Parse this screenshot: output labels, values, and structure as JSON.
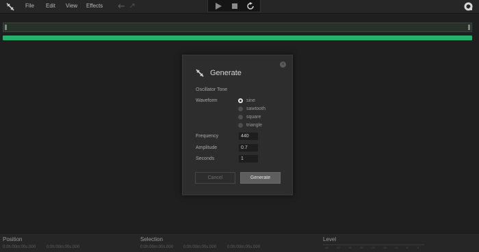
{
  "menu": {
    "file": "File",
    "edit": "Edit",
    "view": "View",
    "effects": "Effects"
  },
  "icons": {
    "logo": "satellite-icon",
    "undo": "undo-icon",
    "redo": "redo-icon",
    "play": "play-icon",
    "stop": "stop-icon",
    "loop": "loop-icon",
    "profile": "profile-icon",
    "close": "close-icon"
  },
  "colors": {
    "accent_green": "#25b06c",
    "background": "#1f1f1f",
    "dialog": "#2d2d2d"
  },
  "dialog": {
    "title": "Generate",
    "subtitle": "Oscillator Tone",
    "close_glyph": "×",
    "waveform_label": "Waveform",
    "waveforms": [
      {
        "label": "sine",
        "selected": true
      },
      {
        "label": "sawtooth",
        "selected": false
      },
      {
        "label": "square",
        "selected": false
      },
      {
        "label": "triangle",
        "selected": false
      }
    ],
    "frequency_label": "Frequency",
    "frequency_value": "440",
    "amplitude_label": "Amplitude",
    "amplitude_value": "0.7",
    "seconds_label": "Seconds",
    "seconds_value": "1",
    "cancel_label": "Cancel",
    "generate_label": "Generate"
  },
  "statusbar": {
    "position_title": "Position",
    "position_start": "0:0h:00m:00s.000",
    "position_end": "0:0h:00m:00s.000",
    "selection_title": "Selection",
    "selection_start": "0:0h:00m:00s.000",
    "selection_mid": "0:0h:00m:00s.000",
    "selection_end": "0:0h:00m:00s.000",
    "level_title": "Level",
    "level_ticks": [
      "-48",
      "-42",
      "-36",
      "-30",
      "-24",
      "-18",
      "-12",
      "-6",
      "0"
    ]
  }
}
